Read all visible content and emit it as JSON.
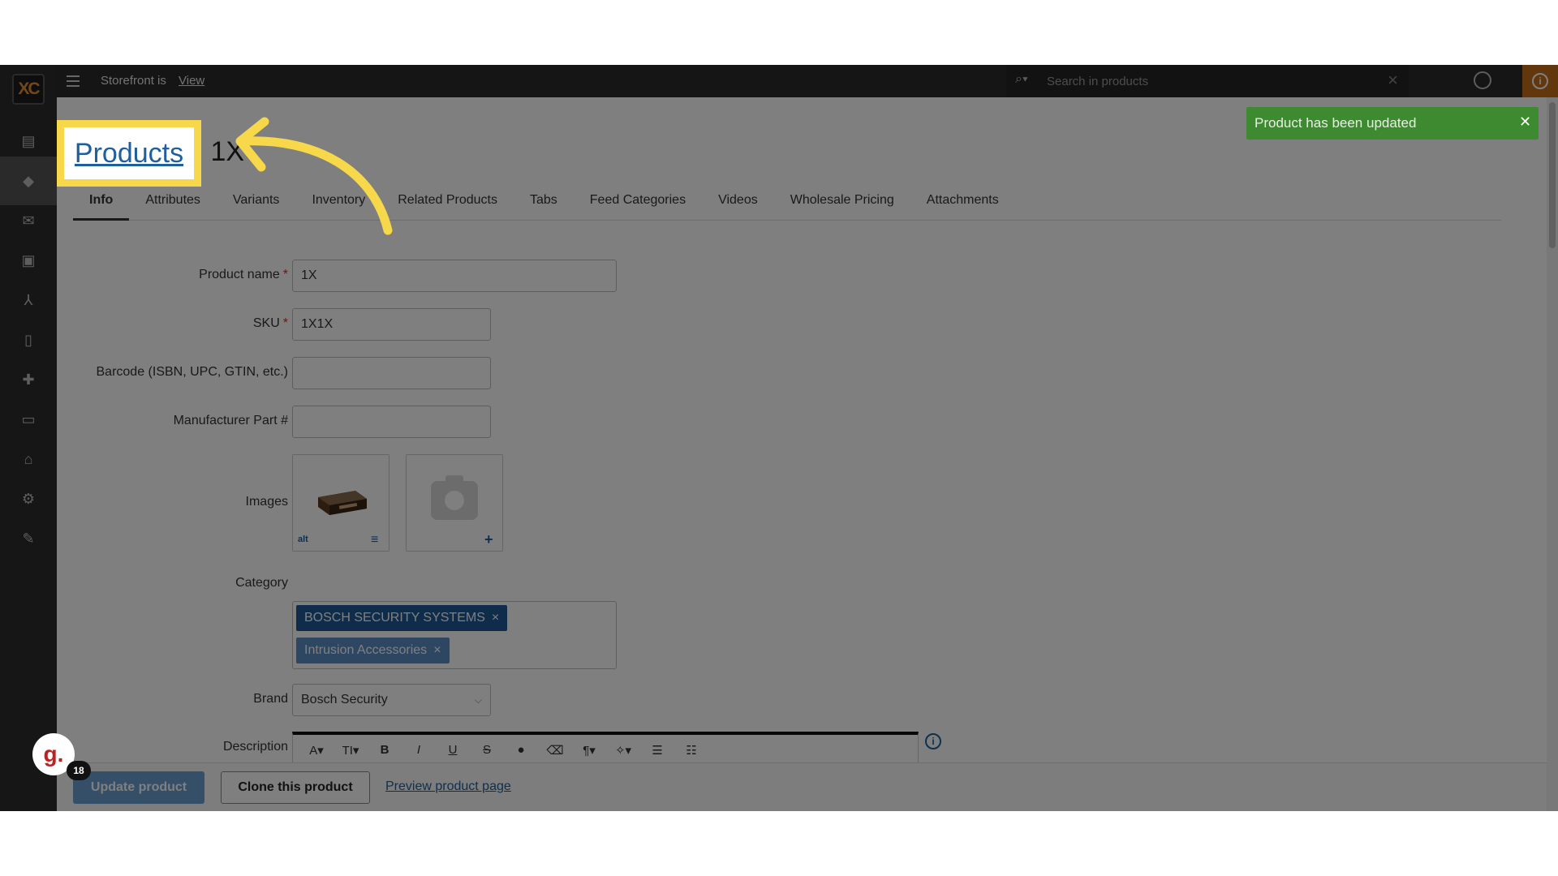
{
  "topbar": {
    "storefront_label": "Storefront is",
    "storefront_view": "View",
    "search_placeholder": "Search in products"
  },
  "breadcrumb": {
    "products": "Products",
    "current": "1X"
  },
  "tabs": [
    "Info",
    "Attributes",
    "Variants",
    "Inventory",
    "Related Products",
    "Tabs",
    "Feed Categories",
    "Videos",
    "Wholesale Pricing",
    "Attachments"
  ],
  "form": {
    "product_name_label": "Product name",
    "product_name_value": "1X",
    "sku_label": "SKU",
    "sku_value": "1X1X",
    "barcode_label": "Barcode (ISBN, UPC, GTIN, etc.)",
    "barcode_value": "",
    "mpn_label": "Manufacturer Part #",
    "mpn_value": "",
    "images_label": "Images",
    "image_alt_label": "alt",
    "category_label": "Category",
    "categories": [
      "BOSCH SECURITY SYSTEMS",
      "Intrusion Accessories"
    ],
    "brand_label": "Brand",
    "brand_value": "Bosch Security",
    "description_label": "Description",
    "required_mark": "*"
  },
  "actions": {
    "update": "Update product",
    "clone": "Clone this product",
    "preview": "Preview product page"
  },
  "toast": {
    "message": "Product has been updated",
    "color": "#3e8a30"
  },
  "help": {
    "badge": "18"
  },
  "colors": {
    "accent": "#1f5f9e",
    "highlight": "#f7d84a",
    "chip_primary": "#1e5a94",
    "chip_secondary": "#5b8fc7"
  }
}
